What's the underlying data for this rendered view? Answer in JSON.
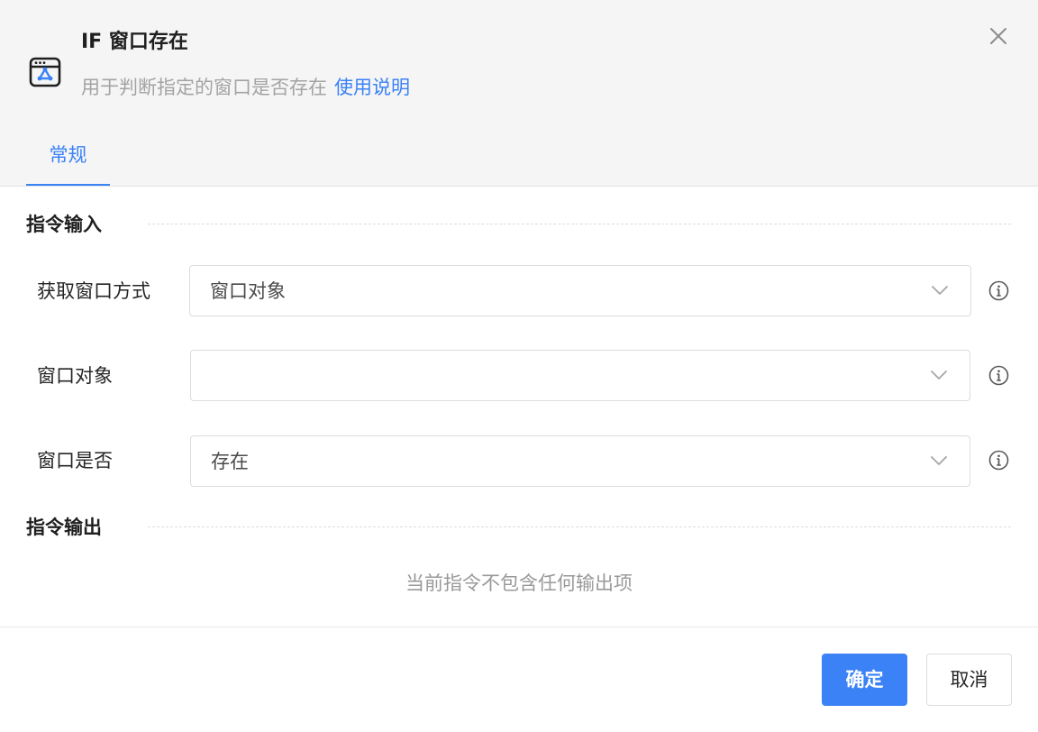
{
  "header": {
    "title": "IF 窗口存在",
    "subtitle": "用于判断指定的窗口是否存在",
    "help_link": "使用说明",
    "icon": "window-app-icon",
    "close_icon": "close-icon"
  },
  "tabs": [
    {
      "label": "常规",
      "active": true
    }
  ],
  "input_section": {
    "title": "指令输入",
    "fields": [
      {
        "label": "获取窗口方式",
        "value": "窗口对象"
      },
      {
        "label": "窗口对象",
        "value": ""
      },
      {
        "label": "窗口是否",
        "value": "存在"
      }
    ]
  },
  "output_section": {
    "title": "指令输出",
    "empty_text": "当前指令不包含任何输出项"
  },
  "footer": {
    "confirm_label": "确定",
    "cancel_label": "取消"
  },
  "colors": {
    "accent": "#3b82f6",
    "header_bg": "#f5f5f5"
  }
}
